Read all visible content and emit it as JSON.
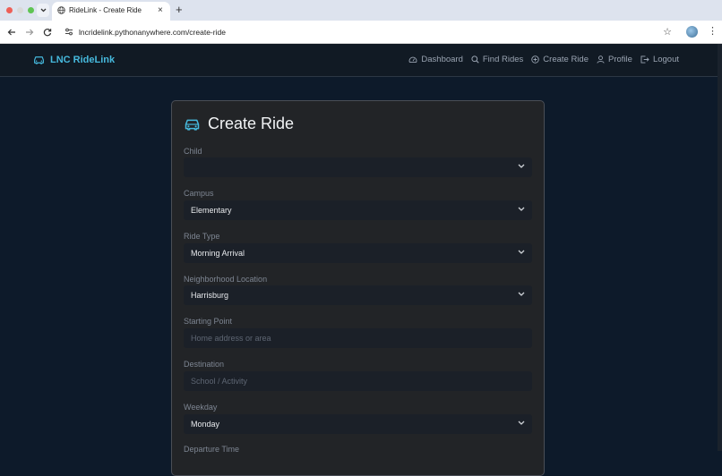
{
  "browser": {
    "tab_title": "RideLink - Create Ride",
    "close_glyph": "×",
    "new_tab_glyph": "+",
    "url": "lncridelink.pythonanywhere.com/create-ride"
  },
  "navbar": {
    "brand": "LNC RideLink",
    "links": [
      {
        "label": "Dashboard",
        "icon": "speedometer-icon"
      },
      {
        "label": "Find Rides",
        "icon": "search-icon"
      },
      {
        "label": "Create Ride",
        "icon": "plus-circle-icon"
      },
      {
        "label": "Profile",
        "icon": "user-icon"
      },
      {
        "label": "Logout",
        "icon": "logout-icon"
      }
    ]
  },
  "form": {
    "title": "Create Ride",
    "fields": [
      {
        "label": "Child",
        "type": "select",
        "value": ""
      },
      {
        "label": "Campus",
        "type": "select",
        "value": "Elementary"
      },
      {
        "label": "Ride Type",
        "type": "select",
        "value": "Morning Arrival"
      },
      {
        "label": "Neighborhood Location",
        "type": "select",
        "value": "Harrisburg"
      },
      {
        "label": "Starting Point",
        "type": "input",
        "placeholder": "Home address or area"
      },
      {
        "label": "Destination",
        "type": "input",
        "placeholder": "School / Activity"
      },
      {
        "label": "Weekday",
        "type": "select",
        "value": "Monday"
      },
      {
        "label": "Departure Time",
        "type": "input"
      }
    ]
  },
  "colors": {
    "accent": "#46b9dd",
    "card_bg": "#222427",
    "control_bg": "#1b2028"
  }
}
